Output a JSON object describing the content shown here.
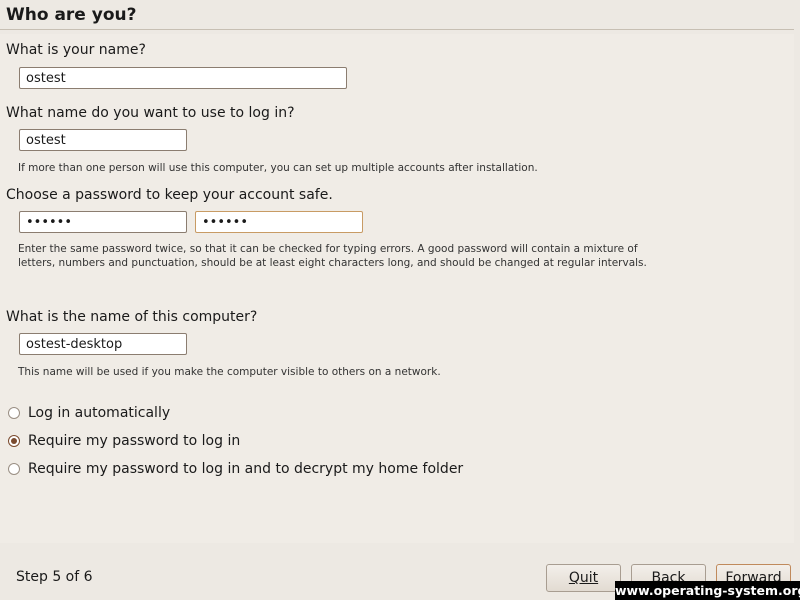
{
  "header": {
    "title": "Who are you?"
  },
  "name_section": {
    "question": "What is your name?",
    "value": "ostest"
  },
  "login_section": {
    "question": "What name do you want to use to log in?",
    "value": "ostest",
    "hint": "If more than one person will use this computer, you can set up multiple accounts after installation."
  },
  "password_section": {
    "question": "Choose a password to keep your account safe.",
    "password_value": "••••••",
    "confirm_value": "••••••",
    "hint": "Enter the same password twice, so that it can be checked for typing errors. A good password will contain a mixture of letters, numbers and punctuation, should be at least eight characters long, and should be changed at regular intervals."
  },
  "computer_section": {
    "question": "What is the name of this computer?",
    "value": "ostest-desktop",
    "hint": "This name will be used if you make the computer visible to others on a network."
  },
  "login_options": {
    "selected": "require_password",
    "items": [
      {
        "id": "auto",
        "label": "Log in automatically",
        "checked": false
      },
      {
        "id": "require_password",
        "label": "Require my password to log in",
        "checked": true
      },
      {
        "id": "require_password_encrypt",
        "label": "Require my password to log in and to decrypt my home folder",
        "checked": false
      }
    ]
  },
  "footer": {
    "step_text": "Step 5 of 6",
    "quit_label": "Quit",
    "back_label": "Back",
    "forward_label": "Forward"
  },
  "watermark": {
    "text": "www.operating-system.org"
  },
  "colors": {
    "background": "#ede9e3",
    "content_background": "#f0ece6",
    "radio_accent": "#7a4a2e",
    "default_button_border": "#c08a5c"
  }
}
